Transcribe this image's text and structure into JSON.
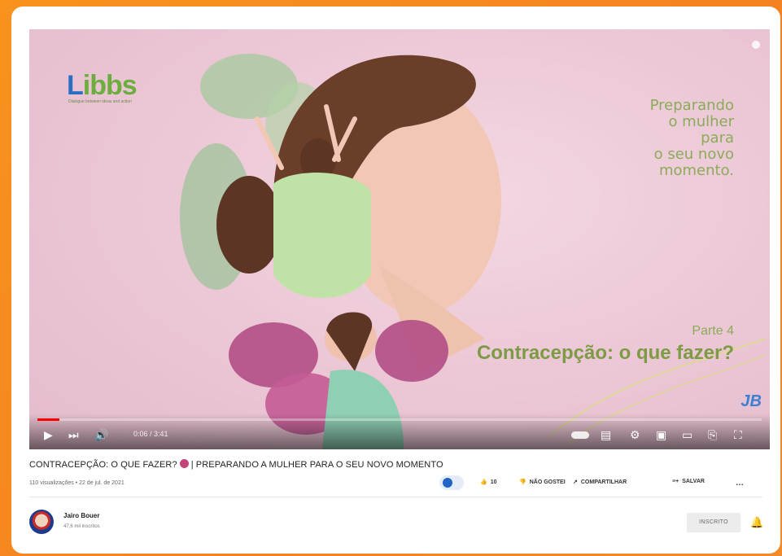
{
  "player": {
    "brand": "Libbs",
    "brand_l": "L",
    "brand_rest": "ibbs",
    "brand_sub": "Dialogue between ideas and action",
    "tagline": "Preparando\no mulher\npara\no seu novo\nmomento.",
    "part": "Parte 4",
    "headline": "Contracepção: o que fazer?",
    "corner_logo": "JB",
    "time": "0:06 / 3:41",
    "progress": 0.03,
    "icons": [
      "play-icon",
      "next-icon",
      "volume-icon",
      "autoplay-toggle",
      "subtitles-icon",
      "settings-icon",
      "miniplayer-icon",
      "theater-icon",
      "cast-icon",
      "fullscreen-icon"
    ]
  },
  "video": {
    "title_before": "CONTRACEPÇÃO: O QUE FAZER?",
    "title_after": "| PREPARANDO A MULHER PARA O SEU NOVO MOMENTO",
    "meta": "110 visualizações • 22 de jul. de 2021",
    "likes": "10",
    "dislike_label": "NÃO GOSTEI",
    "share_label": "COMPARTILHAR",
    "save_label": "SALVAR",
    "more": "…"
  },
  "channel": {
    "name": "Jairo Bouer",
    "subscribers": "47,6 mil inscritos",
    "subscribed_label": "INSCRITO"
  },
  "colors": {
    "accent": "#ff0000",
    "background": "#f58220",
    "headline": "#7d9a44"
  }
}
